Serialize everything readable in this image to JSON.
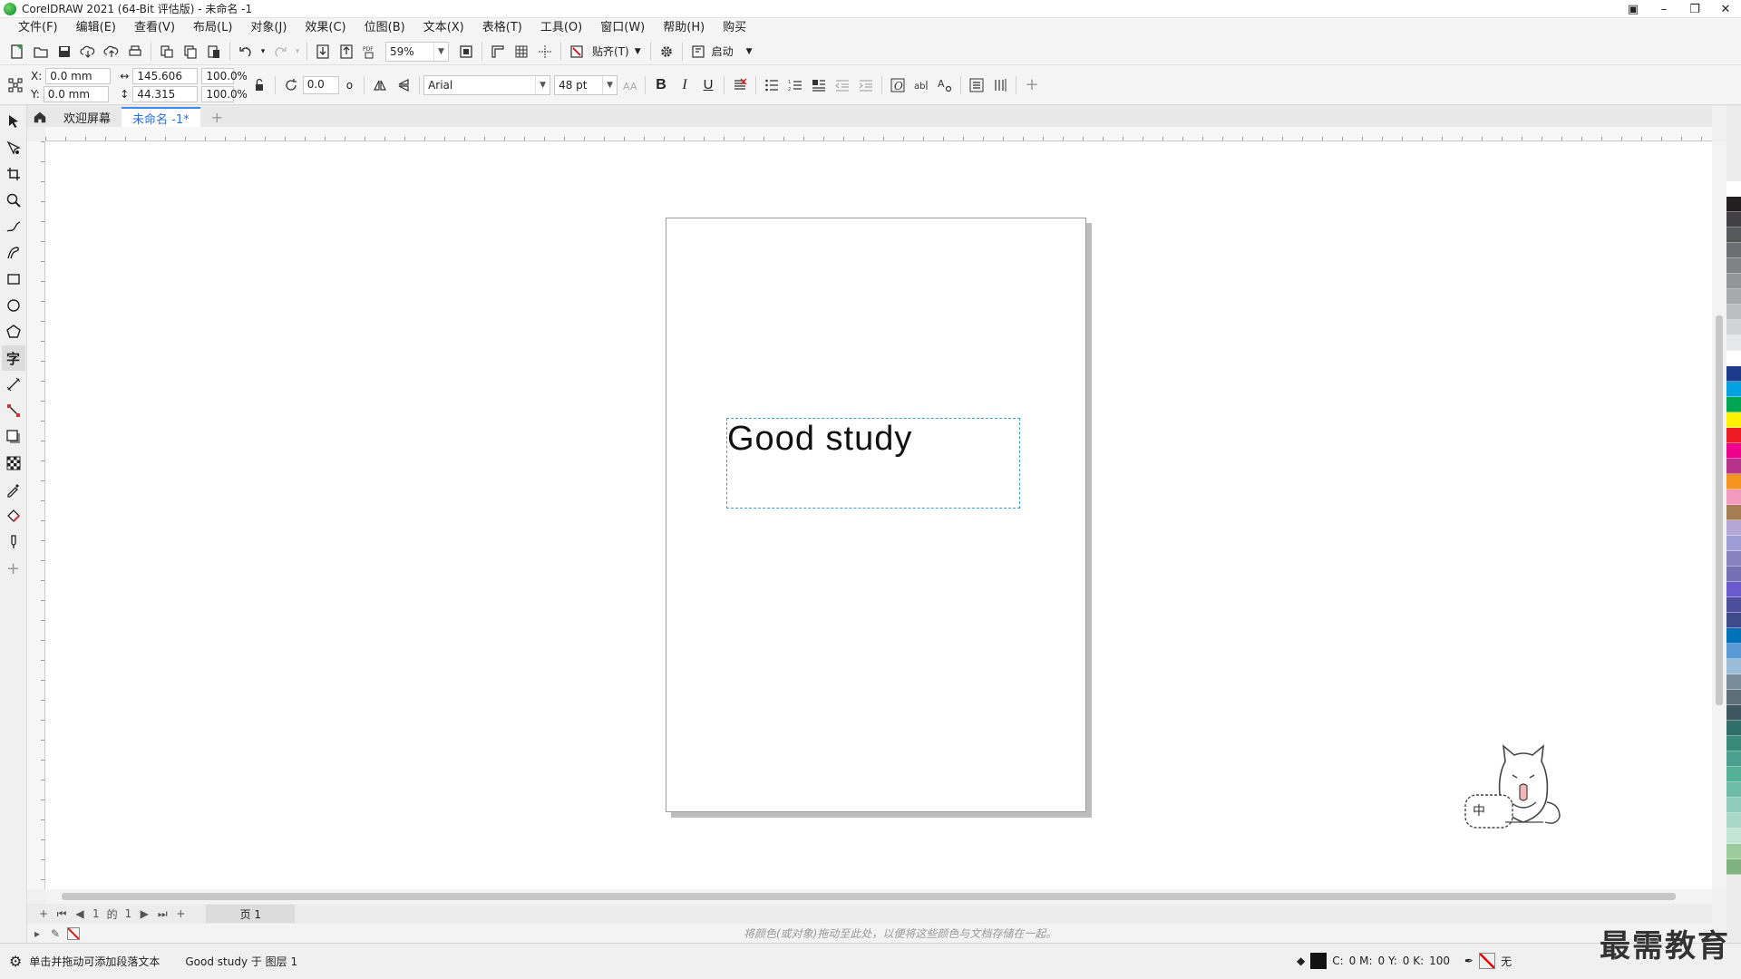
{
  "window": {
    "title": "CorelDRAW 2021 (64-Bit 评估版) - 未命名 -1"
  },
  "menu": [
    "文件(F)",
    "编辑(E)",
    "查看(V)",
    "布局(L)",
    "对象(J)",
    "效果(C)",
    "位图(B)",
    "文本(X)",
    "表格(T)",
    "工具(O)",
    "窗口(W)",
    "帮助(H)",
    "购买"
  ],
  "toolbar": {
    "zoom_value": "59%",
    "snap_label": "贴齐(T)",
    "launch_label": "启动"
  },
  "property_bar": {
    "x_label": "X:",
    "y_label": "Y:",
    "x_value": "0.0 mm",
    "y_value": "0.0 mm",
    "width_value": "145.606 mm",
    "height_value": "44.315 mm",
    "scale_x": "100.0",
    "scale_y": "100.0",
    "percent": "%",
    "rotation": "0.0",
    "rotation_unit": "o",
    "font_name": "Arial",
    "font_size": "48 pt",
    "bold": "B",
    "italic": "I",
    "underline": "U",
    "char_a": "A"
  },
  "tabs": {
    "welcome": "欢迎屏幕",
    "document": "未命名 -1*",
    "add": "+"
  },
  "canvas": {
    "text_object": "Good study"
  },
  "page_nav": {
    "add": "+",
    "current": "1",
    "of": "的",
    "total": "1",
    "page_tab": "页 1"
  },
  "color_tray": {
    "hint": "将颜色(或对象)拖动至此处，以便将这些颜色与文档存储在一起。"
  },
  "status": {
    "hint": "单击并拖动可添加段落文本",
    "selection": "Good study 于 图层 1",
    "color_c": "C:",
    "color_m": "0 M:",
    "color_y": "0 Y:",
    "color_k": "0 K:",
    "color_k_val": "100",
    "outline": "无"
  },
  "watermark": "最需教育",
  "mascot_text": "中",
  "palette": [
    "#ffffff",
    "#231f20",
    "#414042",
    "#58595b",
    "#6d6e71",
    "#808285",
    "#939598",
    "#a7a9ac",
    "#bcbec0",
    "#d1d3d4",
    "#e6e7e8",
    "#ffffff",
    "#1e3a8a",
    "#00a3e0",
    "#00a651",
    "#fff200",
    "#ed1c24",
    "#ec008c",
    "#b5338a",
    "#f7941d",
    "#f49ac1",
    "#a67c52",
    "#b4a7d6",
    "#9e9ed6",
    "#8781bd",
    "#7570b3",
    "#6a5acd",
    "#4b4e9a",
    "#3f4a8a",
    "#0072bc",
    "#5b9bd5",
    "#9bbcd6",
    "#7a8b99",
    "#5f6f7a",
    "#3e5660",
    "#2f6f6a",
    "#3a8a7a",
    "#4aa08c",
    "#55b09a",
    "#6dbca8",
    "#8fcbb8",
    "#a9d8c8",
    "#c2e4d6",
    "#9ccc9c",
    "#7fb27f"
  ]
}
